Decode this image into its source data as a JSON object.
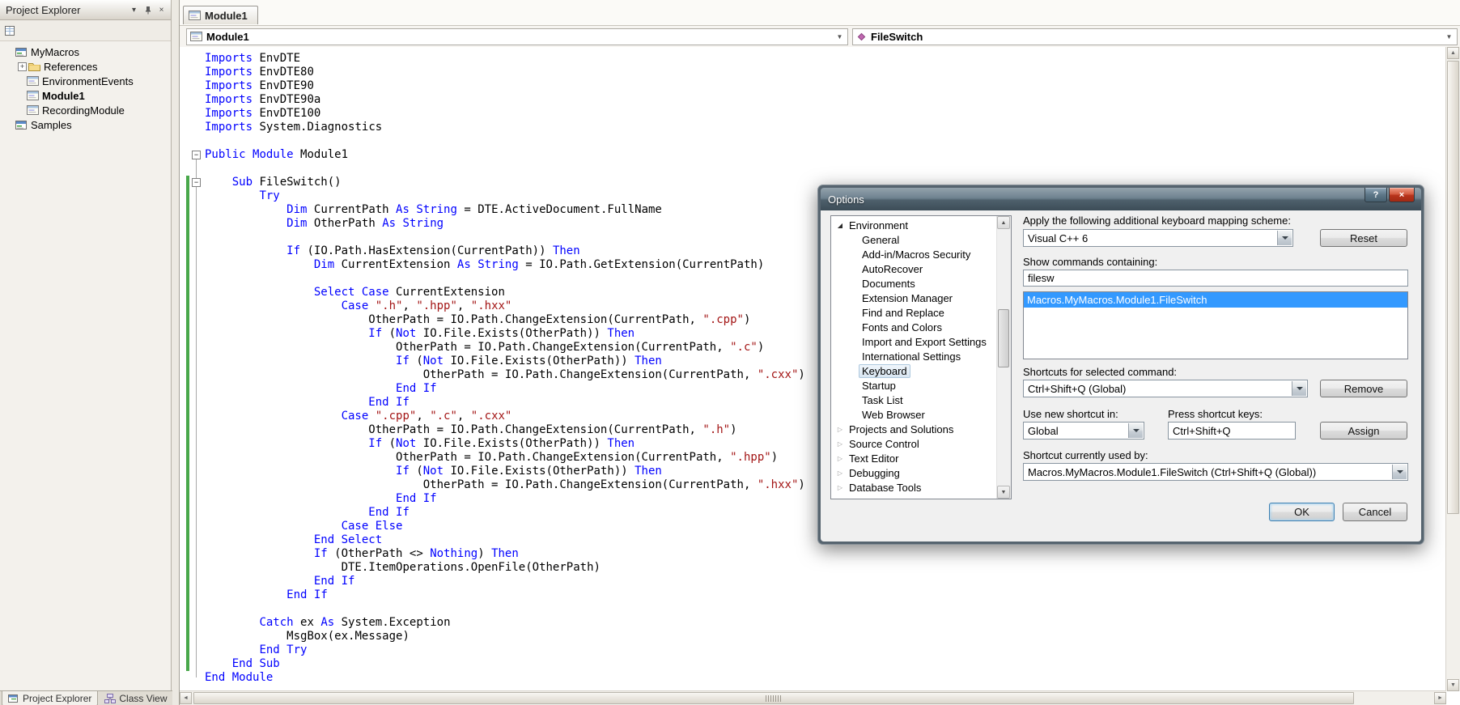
{
  "glyphs": {
    "panel_menu": "▾",
    "panel_close": "×",
    "dialog_help": "?",
    "dialog_close": "×",
    "combo_arrow": "▼",
    "scroll_up": "▲",
    "scroll_down": "▼",
    "scroll_left": "◄",
    "scroll_right": "►",
    "tree_expanded": "◢",
    "tree_collapsed": "▷",
    "fold_minus": "−",
    "plus_expander": "+"
  },
  "colors": {
    "keyword": "#0000FF",
    "string": "#A31515",
    "selection": "#3399FF",
    "change_bar": "#49A84B"
  },
  "project_explorer": {
    "title": "Project Explorer",
    "tree": [
      {
        "label": "MyMacros",
        "indent": 0,
        "icon": "macro-project"
      },
      {
        "label": "References",
        "indent": 1,
        "icon": "references",
        "expander": "plus"
      },
      {
        "label": "EnvironmentEvents",
        "indent": 1,
        "icon": "module"
      },
      {
        "label": "Module1",
        "indent": 1,
        "icon": "module",
        "bold": true
      },
      {
        "label": "RecordingModule",
        "indent": 1,
        "icon": "module"
      },
      {
        "label": "Samples",
        "indent": 0,
        "icon": "macro-project"
      }
    ],
    "bottom_tabs": [
      {
        "label": "Project Explorer",
        "active": true
      },
      {
        "label": "Class View",
        "active": false
      }
    ]
  },
  "editor": {
    "tab_label": "Module1",
    "nav_left": "Module1",
    "nav_right": "FileSwitch",
    "code_lines": [
      "Imports EnvDTE",
      "Imports EnvDTE80",
      "Imports EnvDTE90",
      "Imports EnvDTE90a",
      "Imports EnvDTE100",
      "Imports System.Diagnostics",
      "",
      "Public Module Module1",
      "",
      "    Sub FileSwitch()",
      "        Try",
      "            Dim CurrentPath As String = DTE.ActiveDocument.FullName",
      "            Dim OtherPath As String",
      "",
      "            If (IO.Path.HasExtension(CurrentPath)) Then",
      "                Dim CurrentExtension As String = IO.Path.GetExtension(CurrentPath)",
      "",
      "                Select Case CurrentExtension",
      "                    Case \".h\", \".hpp\", \".hxx\"",
      "                        OtherPath = IO.Path.ChangeExtension(CurrentPath, \".cpp\")",
      "                        If (Not IO.File.Exists(OtherPath)) Then",
      "                            OtherPath = IO.Path.ChangeExtension(CurrentPath, \".c\")",
      "                            If (Not IO.File.Exists(OtherPath)) Then",
      "                                OtherPath = IO.Path.ChangeExtension(CurrentPath, \".cxx\")",
      "                            End If",
      "                        End If",
      "                    Case \".cpp\", \".c\", \".cxx\"",
      "                        OtherPath = IO.Path.ChangeExtension(CurrentPath, \".h\")",
      "                        If (Not IO.File.Exists(OtherPath)) Then",
      "                            OtherPath = IO.Path.ChangeExtension(CurrentPath, \".hpp\")",
      "                            If (Not IO.File.Exists(OtherPath)) Then",
      "                                OtherPath = IO.Path.ChangeExtension(CurrentPath, \".hxx\")",
      "                            End If",
      "                        End If",
      "                    Case Else",
      "                End Select",
      "                If (OtherPath <> Nothing) Then",
      "                    DTE.ItemOperations.OpenFile(OtherPath)",
      "                End If",
      "            End If",
      "",
      "        Catch ex As System.Exception",
      "            MsgBox(ex.Message)",
      "        End Try",
      "    End Sub",
      "End Module"
    ]
  },
  "options_dialog": {
    "title": "Options",
    "tree": [
      {
        "label": "Environment",
        "level": 0,
        "state": "expanded"
      },
      {
        "label": "General",
        "level": 1
      },
      {
        "label": "Add-in/Macros Security",
        "level": 1
      },
      {
        "label": "AutoRecover",
        "level": 1
      },
      {
        "label": "Documents",
        "level": 1
      },
      {
        "label": "Extension Manager",
        "level": 1
      },
      {
        "label": "Find and Replace",
        "level": 1
      },
      {
        "label": "Fonts and Colors",
        "level": 1
      },
      {
        "label": "Import and Export Settings",
        "level": 1
      },
      {
        "label": "International Settings",
        "level": 1
      },
      {
        "label": "Keyboard",
        "level": 1,
        "selected": true
      },
      {
        "label": "Startup",
        "level": 1
      },
      {
        "label": "Task List",
        "level": 1
      },
      {
        "label": "Web Browser",
        "level": 1
      },
      {
        "label": "Projects and Solutions",
        "level": 0,
        "state": "collapsed"
      },
      {
        "label": "Source Control",
        "level": 0,
        "state": "collapsed"
      },
      {
        "label": "Text Editor",
        "level": 0,
        "state": "collapsed"
      },
      {
        "label": "Debugging",
        "level": 0,
        "state": "collapsed"
      },
      {
        "label": "Database Tools",
        "level": 0,
        "state": "collapsed"
      }
    ],
    "mapping_label": "Apply the following additional keyboard mapping scheme:",
    "mapping_value": "Visual C++ 6",
    "reset_button": "Reset",
    "commands_label": "Show commands containing:",
    "commands_filter": "filesw",
    "commands_list": [
      {
        "label": "Macros.MyMacros.Module1.FileSwitch",
        "selected": true
      }
    ],
    "shortcuts_label": "Shortcuts for selected command:",
    "shortcuts_value": "Ctrl+Shift+Q (Global)",
    "remove_button": "Remove",
    "use_in_label": "Use new shortcut in:",
    "use_in_value": "Global",
    "press_keys_label": "Press shortcut keys:",
    "press_keys_value": "Ctrl+Shift+Q",
    "assign_button": "Assign",
    "used_by_label": "Shortcut currently used by:",
    "used_by_value": "Macros.MyMacros.Module1.FileSwitch (Ctrl+Shift+Q (Global))",
    "ok_button": "OK",
    "cancel_button": "Cancel"
  }
}
